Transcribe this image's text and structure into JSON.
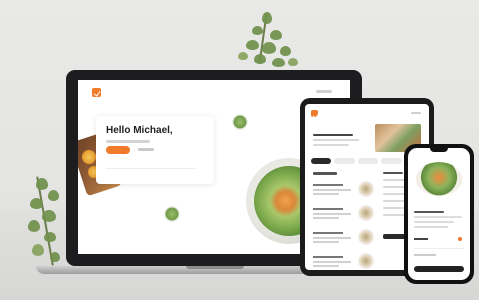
{
  "scene": {
    "description_free": true
  },
  "laptop_app": {
    "greeting": "Hello Michael,",
    "accent_color": "#f07b2b",
    "logo_icon": "check-logo-icon"
  },
  "tablet_app": {
    "accent_color": "#f07b2b",
    "logo_icon": "check-logo-icon"
  },
  "phone_app": {
    "accent_color": "#f07b2b"
  }
}
